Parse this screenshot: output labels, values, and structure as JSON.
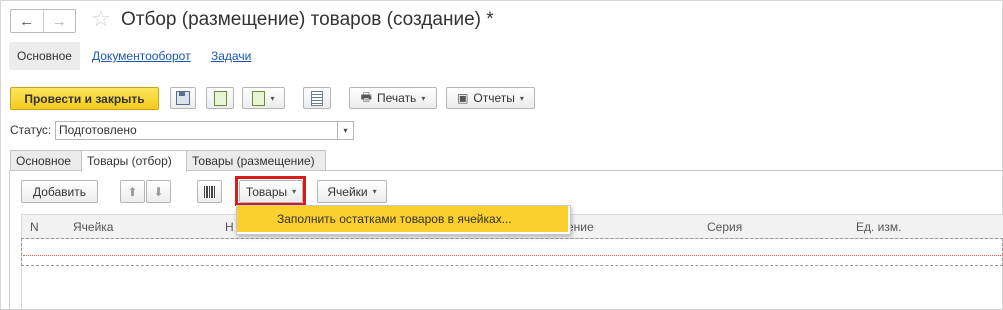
{
  "window": {
    "title": "Отбор (размещение) товаров (создание) *",
    "back_glyph": "←",
    "forward_glyph": "→",
    "star_glyph": "☆"
  },
  "section_tabs": [
    {
      "label": "Основное",
      "active": true
    },
    {
      "label": "Документооборот",
      "active": false
    },
    {
      "label": "Задачи",
      "active": false
    }
  ],
  "toolbar": {
    "post_close_label": "Провести и закрыть",
    "print_label": "Печать",
    "reports_label": "Отчеты",
    "caret": "▾",
    "print_glyph": "🖶",
    "reports_glyph": "▣",
    "accent": "#f4cb1e"
  },
  "status": {
    "label": "Статус:",
    "value": "Подготовлено",
    "caret": "▾"
  },
  "page_tabs": [
    {
      "label": "Основное"
    },
    {
      "label": "Товары (отбор)",
      "active": true
    },
    {
      "label": "Товары (размещение)"
    }
  ],
  "inner_toolbar": {
    "add_label": "Добавить",
    "up_glyph": "⬆",
    "down_glyph": "⬇",
    "goods_label": "Товары",
    "cells_label": "Ячейки",
    "caret": "▾"
  },
  "table": {
    "columns": [
      "N",
      "Ячейка",
      "Н",
      "ение",
      "Серия",
      "Ед. изм."
    ]
  },
  "dropdown": {
    "items": [
      "Заполнить остатками товаров в ячейках..."
    ],
    "highlight_color": "#fbcf2d"
  },
  "colors": {
    "link": "#1c56b4",
    "annotation_red": "#d91b1b"
  }
}
